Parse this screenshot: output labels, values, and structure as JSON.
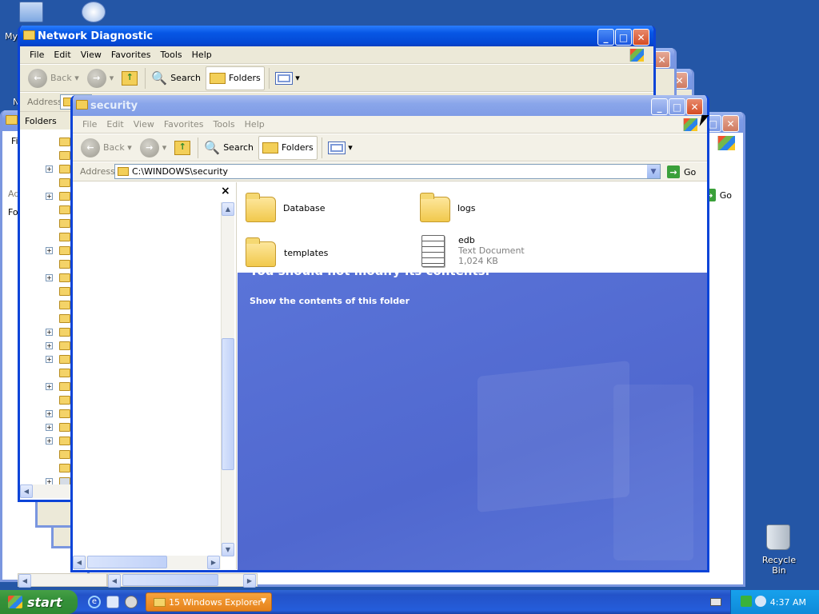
{
  "desktop": {
    "icons": {
      "my_computer_partial": "My",
      "recycle_bin": "Recycle Bin",
      "left_edge_fragment": "N"
    }
  },
  "menu_items": [
    "File",
    "Edit",
    "View",
    "Favorites",
    "Tools",
    "Help"
  ],
  "toolbar": {
    "back": "Back",
    "search": "Search",
    "folders": "Folders"
  },
  "address_label": "Address",
  "go_label": "Go",
  "windows": {
    "network_diagnostic": {
      "title": "Network Diagnostic",
      "folders_label": "Folders"
    },
    "background_fragments": {
      "first_label_partial": "Fi",
      "address_partial": "Ad",
      "folders_partial": "Fo"
    },
    "security": {
      "title": "security",
      "address_value": "C:\\WINDOWS\\security",
      "close_pane": "×",
      "items": [
        {
          "name": "Database",
          "type": "folder"
        },
        {
          "name": "logs",
          "type": "folder"
        },
        {
          "name": "templates",
          "type": "folder"
        },
        {
          "name": "edb",
          "type": "file",
          "kind": "Text Document",
          "size": "1,024 KB"
        }
      ],
      "overlay_partial_text": "You should not modify its contents.",
      "show_contents_link": "Show the contents of this folder"
    }
  },
  "taskbar": {
    "start": "start",
    "task_group": "15 Windows Explorer",
    "clock": "4:37 AM"
  },
  "colors": {
    "desktop": "#2456a6",
    "titlebar_active": "#0757e5",
    "overlay_blue": "#5470d6",
    "start_green": "#35913a",
    "task_orange": "#e5821c"
  }
}
